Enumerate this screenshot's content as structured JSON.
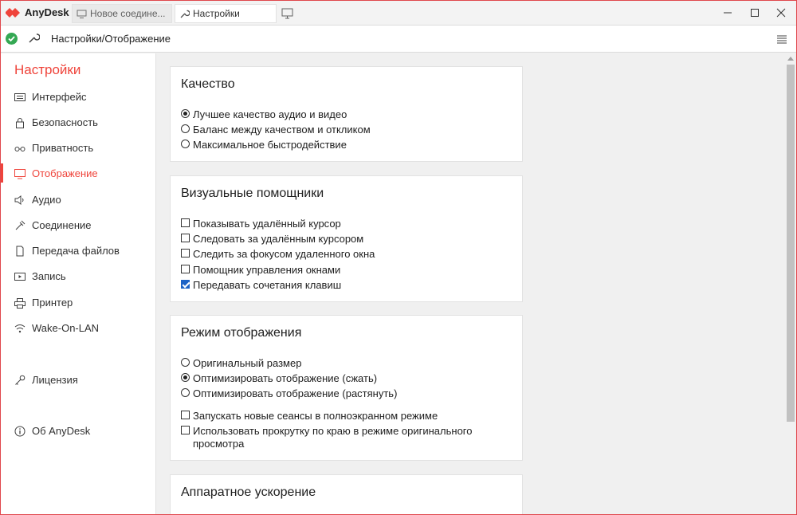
{
  "app": {
    "title": "AnyDesk"
  },
  "tabs": [
    {
      "label": "Новое соедине..."
    },
    {
      "label": "Настройки"
    }
  ],
  "address": {
    "path": "Настройки/Отображение"
  },
  "sidebar": {
    "title": "Настройки",
    "items": [
      {
        "label": "Интерфейс",
        "icon": "keyboard-icon"
      },
      {
        "label": "Безопасность",
        "icon": "lock-icon"
      },
      {
        "label": "Приватность",
        "icon": "glasses-icon"
      },
      {
        "label": "Отображение",
        "icon": "monitor-icon"
      },
      {
        "label": "Аудио",
        "icon": "speaker-icon"
      },
      {
        "label": "Соединение",
        "icon": "plug-icon"
      },
      {
        "label": "Передача файлов",
        "icon": "file-icon"
      },
      {
        "label": "Запись",
        "icon": "record-icon"
      },
      {
        "label": "Принтер",
        "icon": "printer-icon"
      },
      {
        "label": "Wake-On-LAN",
        "icon": "wifi-icon"
      },
      {
        "label": "Лицензия",
        "icon": "key-icon"
      },
      {
        "label": "Об AnyDesk",
        "icon": "info-icon"
      }
    ]
  },
  "panels": {
    "quality": {
      "title": "Качество",
      "options": [
        {
          "label": "Лучшее качество аудио и видео",
          "selected": true
        },
        {
          "label": "Баланс между качеством и откликом",
          "selected": false
        },
        {
          "label": "Максимальное быстродействие",
          "selected": false
        }
      ]
    },
    "visual": {
      "title": "Визуальные помощники",
      "options": [
        {
          "label": "Показывать удалённый курсор",
          "checked": false
        },
        {
          "label": "Следовать за удалённым курсором",
          "checked": false
        },
        {
          "label": "Следить за фокусом удаленного окна",
          "checked": false
        },
        {
          "label": "Помощник управления окнами",
          "checked": false
        },
        {
          "label": "Передавать сочетания клавиш",
          "checked": true
        }
      ]
    },
    "display": {
      "title": "Режим отображения",
      "options": [
        {
          "label": "Оригинальный размер",
          "selected": false
        },
        {
          "label": "Оптимизировать отображение (сжать)",
          "selected": true
        },
        {
          "label": "Оптимизировать отображение (растянуть)",
          "selected": false
        }
      ],
      "checks": [
        {
          "label": "Запускать новые сеансы в полноэкранном режиме",
          "checked": false
        },
        {
          "label": "Использовать прокрутку по краю в режиме оригинального просмотра",
          "checked": false
        }
      ]
    },
    "hardware": {
      "title": "Аппаратное ускорение"
    }
  },
  "colors": {
    "accent": "#ef443b",
    "check": "#1d63c6",
    "online": "#34a853"
  }
}
